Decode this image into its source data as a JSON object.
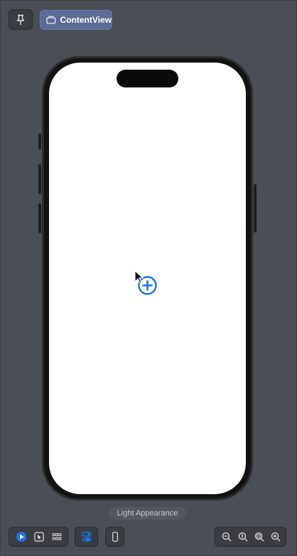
{
  "toolbar": {
    "pin_icon": "pin-icon",
    "tab_label": "ContentView",
    "tab_icon": "stack-icon"
  },
  "canvas": {
    "add_button_icon": "plus-circle-icon",
    "accent_color": "#1a73e8"
  },
  "footer": {
    "appearance_label": "Light Appearance",
    "mode_icons": [
      "live-preview-icon",
      "selectable-icon",
      "variants-icon"
    ],
    "settings_icon": "device-settings-icon",
    "device_icon": "iphone-icon",
    "zoom_icons": [
      "zoom-out-icon",
      "zoom-actual-icon",
      "zoom-fit-icon",
      "zoom-in-icon"
    ]
  }
}
